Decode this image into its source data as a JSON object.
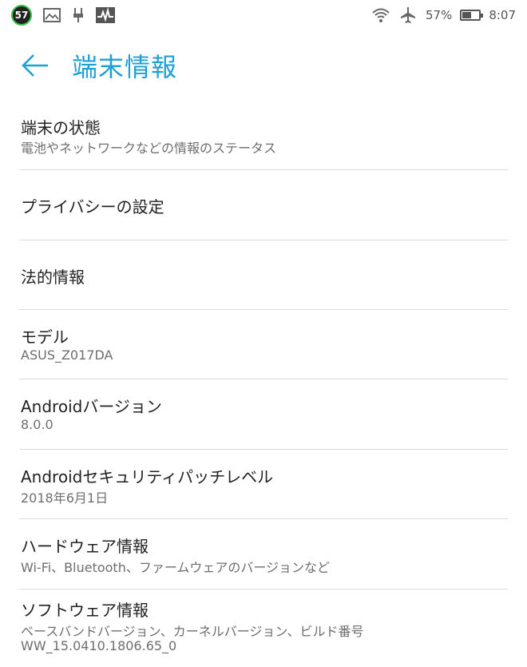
{
  "status_bar": {
    "notification_count": "57",
    "battery_percent_text": "57%",
    "battery_level": 0.57,
    "time": "8:07",
    "left_icons": [
      "notification-badge",
      "image-icon",
      "usb-debug-icon",
      "activity-monitor-icon"
    ],
    "right_icons": [
      "wifi-icon",
      "airplane-mode-icon",
      "battery-icon"
    ]
  },
  "app_bar": {
    "title": "端末情報",
    "back_icon": "arrow-left-icon",
    "accent_color": "#1ea0d4"
  },
  "items": [
    {
      "title": "端末の状態",
      "subtitle": "電池やネットワークなどの情報のステータス"
    },
    {
      "title": "プライバシーの設定"
    },
    {
      "title": "法的情報"
    },
    {
      "title": "モデル",
      "subtitle": "ASUS_Z017DA"
    },
    {
      "title": "Androidバージョン",
      "subtitle": "8.0.0"
    },
    {
      "title": "Androidセキュリティパッチレベル",
      "subtitle": "2018年6月1日"
    },
    {
      "title": "ハードウェア情報",
      "subtitle": "Wi-Fi、Bluetooth、ファームウェアのバージョンなど"
    },
    {
      "title": "ソフトウェア情報",
      "subtitle": "ベースバンドバージョン、カーネルバージョン、ビルド番号",
      "subtitle2": "WW_15.0410.1806.65_0"
    }
  ]
}
